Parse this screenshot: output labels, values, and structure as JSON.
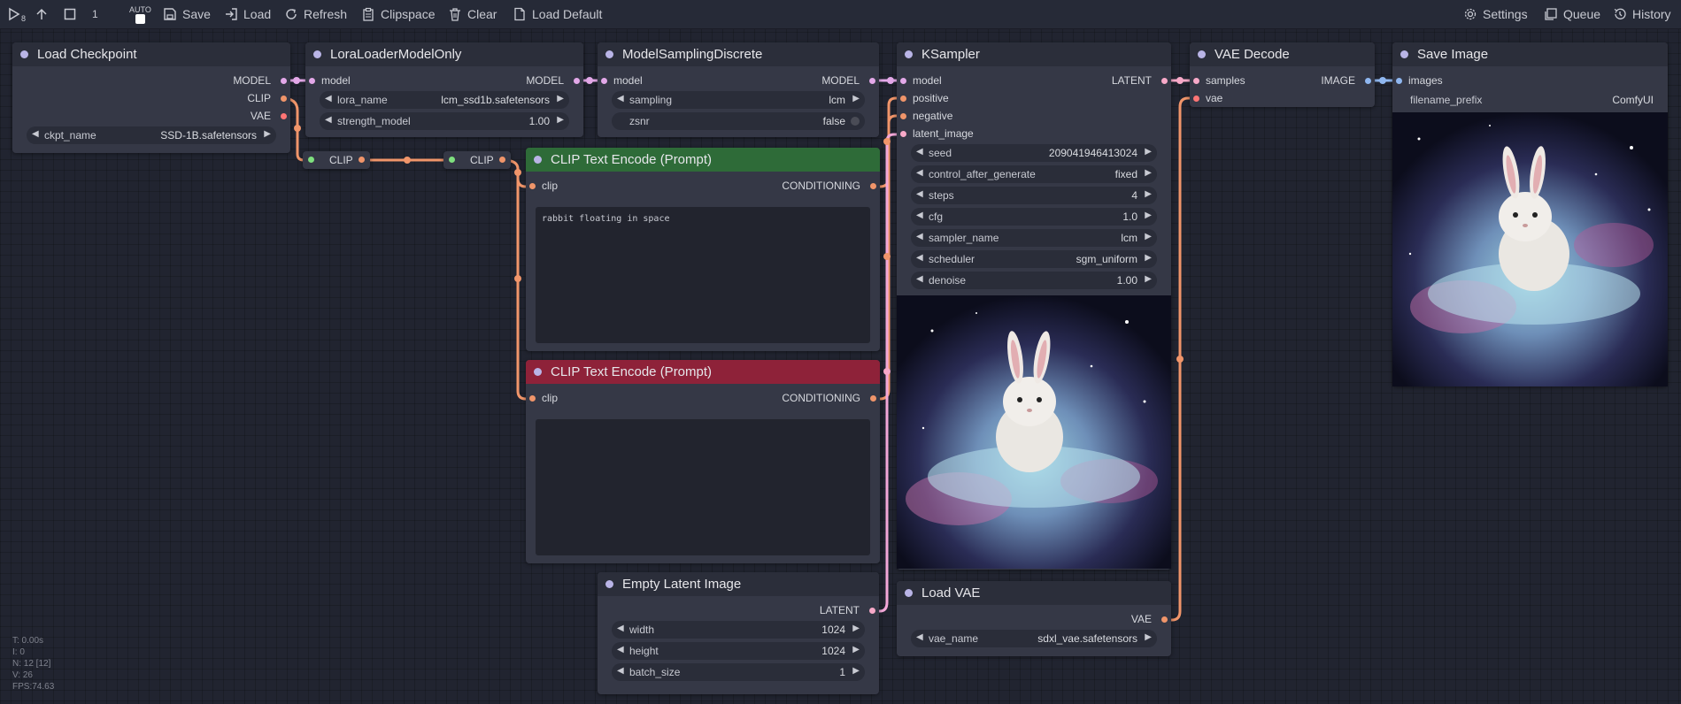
{
  "toolbar": {
    "queue_count": "1",
    "queue_sub": "8",
    "auto_label": "AUTO",
    "save": "Save",
    "load": "Load",
    "refresh": "Refresh",
    "clipspace": "Clipspace",
    "clear": "Clear",
    "load_default": "Load Default",
    "settings": "Settings",
    "queue": "Queue",
    "history": "History"
  },
  "nodes": {
    "load_checkpoint": {
      "title": "Load Checkpoint",
      "out_model": "MODEL",
      "out_clip": "CLIP",
      "out_vae": "VAE",
      "w_label": "ckpt_name",
      "w_value": "SSD-1B.safetensors"
    },
    "lora": {
      "title": "LoraLoaderModelOnly",
      "in_model": "model",
      "out_model": "MODEL",
      "w1_label": "lora_name",
      "w1_value": "lcm_ssd1b.safetensors",
      "w2_label": "strength_model",
      "w2_value": "1.00"
    },
    "reroute": {
      "clip1": "CLIP",
      "clip2": "CLIP"
    },
    "msd": {
      "title": "ModelSamplingDiscrete",
      "in_model": "model",
      "out_model": "MODEL",
      "w1_label": "sampling",
      "w1_value": "lcm",
      "w2_label": "zsnr",
      "w2_value": "false"
    },
    "clip_pos": {
      "title": "CLIP Text Encode (Prompt)",
      "in_clip": "clip",
      "out": "CONDITIONING",
      "text": "rabbit floating in space"
    },
    "clip_neg": {
      "title": "CLIP Text Encode (Prompt)",
      "in_clip": "clip",
      "out": "CONDITIONING",
      "text": ""
    },
    "ksampler": {
      "title": "KSampler",
      "in_model": "model",
      "in_positive": "positive",
      "in_negative": "negative",
      "in_latent": "latent_image",
      "out": "LATENT",
      "widgets": [
        {
          "label": "seed",
          "value": "209041946413024"
        },
        {
          "label": "control_after_generate",
          "value": "fixed"
        },
        {
          "label": "steps",
          "value": "4"
        },
        {
          "label": "cfg",
          "value": "1.0"
        },
        {
          "label": "sampler_name",
          "value": "lcm"
        },
        {
          "label": "scheduler",
          "value": "sgm_uniform"
        },
        {
          "label": "denoise",
          "value": "1.00"
        }
      ]
    },
    "vae_decode": {
      "title": "VAE Decode",
      "in_samples": "samples",
      "in_vae": "vae",
      "out": "IMAGE"
    },
    "save_image": {
      "title": "Save Image",
      "in_images": "images",
      "w_label": "filename_prefix",
      "w_value": "ComfyUI"
    },
    "empty_latent": {
      "title": "Empty Latent Image",
      "out": "LATENT",
      "w1_label": "width",
      "w1_value": "1024",
      "w2_label": "height",
      "w2_value": "1024",
      "w3_label": "batch_size",
      "w3_value": "1"
    },
    "load_vae": {
      "title": "Load VAE",
      "out": "VAE",
      "w_label": "vae_name",
      "w_value": "sdxl_vae.safetensors"
    }
  },
  "stats": {
    "t": "T: 0.00s",
    "i": "I: 0",
    "n": "N: 12 [12]",
    "v": "V: 26",
    "fps": "FPS:74.63"
  },
  "colors": {
    "model": "#b39ddb",
    "clip": "#ffd500",
    "conditioning": "#ffa931",
    "latent": "#ff9cf9",
    "vae": "#ff6e6e",
    "image": "#64b5f6",
    "link_orange": "#f0956a"
  }
}
